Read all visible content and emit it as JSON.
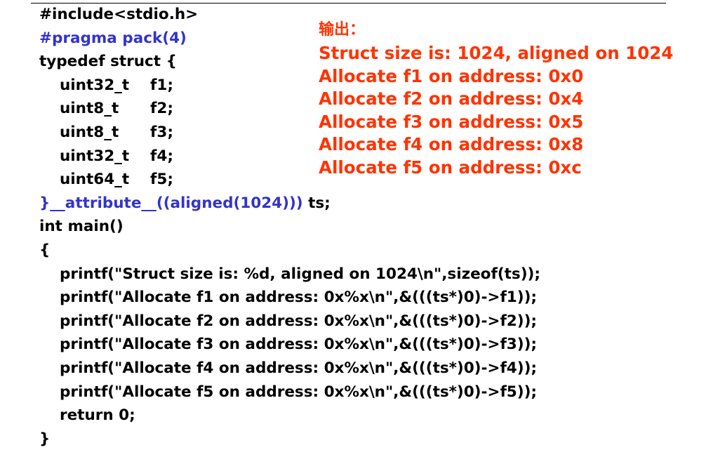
{
  "code": {
    "include_line": "#include<stdio.h>",
    "pragma_line": "#pragma pack(4)",
    "typedef_line": "typedef struct {",
    "fields": [
      {
        "type": "uint32_t",
        "name": "f1;"
      },
      {
        "type": "uint8_t",
        "name": "f2;"
      },
      {
        "type": "uint8_t",
        "name": "f3;"
      },
      {
        "type": "uint32_t",
        "name": "f4;"
      },
      {
        "type": "uint64_t",
        "name": "f5;"
      }
    ],
    "attribute_part": "}__attribute__((aligned(1024)))",
    "typedef_name": " ts;",
    "main_line": "int main()",
    "open_brace": "{",
    "body_lines": [
      "printf(\"Struct size is: %d, aligned on 1024\\n\",sizeof(ts));",
      "printf(\"Allocate f1 on address: 0x%x\\n\",&(((ts*)0)->f1));",
      "printf(\"Allocate f2 on address: 0x%x\\n\",&(((ts*)0)->f2));",
      "printf(\"Allocate f3 on address: 0x%x\\n\",&(((ts*)0)->f3));",
      "printf(\"Allocate f4 on address: 0x%x\\n\",&(((ts*)0)->f4));",
      "printf(\"Allocate f5 on address: 0x%x\\n\",&(((ts*)0)->f5));",
      "return 0;"
    ],
    "close_brace": "}"
  },
  "output": {
    "heading": "输出：",
    "lines": [
      "Struct size is: 1024, aligned on 1024",
      "Allocate f1 on address: 0x0",
      "Allocate f2 on address: 0x4",
      "Allocate f3 on address: 0x5",
      "Allocate f4 on address: 0x8",
      "Allocate f5 on address: 0xc"
    ]
  },
  "colors": {
    "code_text": "#000000",
    "directive_blue": "#3333cc",
    "output_red": "#ff3300"
  }
}
